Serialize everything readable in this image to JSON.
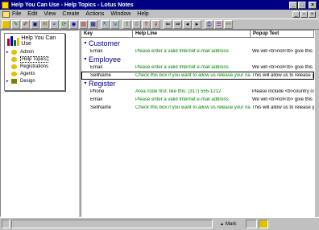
{
  "window": {
    "title": "Help You Can Use - Help Topics - Lotus Notes"
  },
  "menu": [
    "File",
    "Edit",
    "View",
    "Create",
    "Actions",
    "Window",
    "Help"
  ],
  "navigator": {
    "title": "Help You Can Use",
    "items": [
      {
        "label": "Admin",
        "expander": "▸"
      },
      {
        "label": "Help Topics",
        "expander": ""
      },
      {
        "label": "Registrations",
        "expander": ""
      },
      {
        "label": "Agents",
        "expander": ""
      },
      {
        "label": "Design",
        "expander": "▸"
      }
    ]
  },
  "view": {
    "columns": [
      "Key",
      "Help Line",
      "Popup Text"
    ],
    "categories": [
      {
        "name": "Customer",
        "twistie": "▾",
        "rows": [
          {
            "key": "Email",
            "help": "Please enter a valid Internet e-mail address",
            "popup": "We will <b>not</b> give this addr"
          }
        ]
      },
      {
        "name": "Employee",
        "twistie": "▾",
        "rows": [
          {
            "key": "Email",
            "help": "Please enter a valid Internet e-mail address",
            "popup": "We will <b>not</b> give this addr"
          },
          {
            "key": "SellName",
            "help": "Check this box if you want to allow us release your name",
            "popup": "This will allow us to release your"
          }
        ]
      },
      {
        "name": "Register",
        "twistie": "▾",
        "rows": [
          {
            "key": "Phone",
            "help": "Area code first, like this:  (317) 555-1212",
            "popup": "Please include <b>country code"
          },
          {
            "key": "Email",
            "help": "Please enter a valid Internet e-mail address",
            "popup": "We will <b>not</b> give this addr"
          },
          {
            "key": "SellName",
            "help": "Check this box if you want to allow us release your name",
            "popup": "This will allow us to release your"
          }
        ]
      }
    ]
  },
  "status": {
    "mark_label": "Mark"
  },
  "colors": {
    "title_bg": "#000080",
    "category": "#000080",
    "help_text": "#008000",
    "chrome": "#c0c0c0"
  }
}
